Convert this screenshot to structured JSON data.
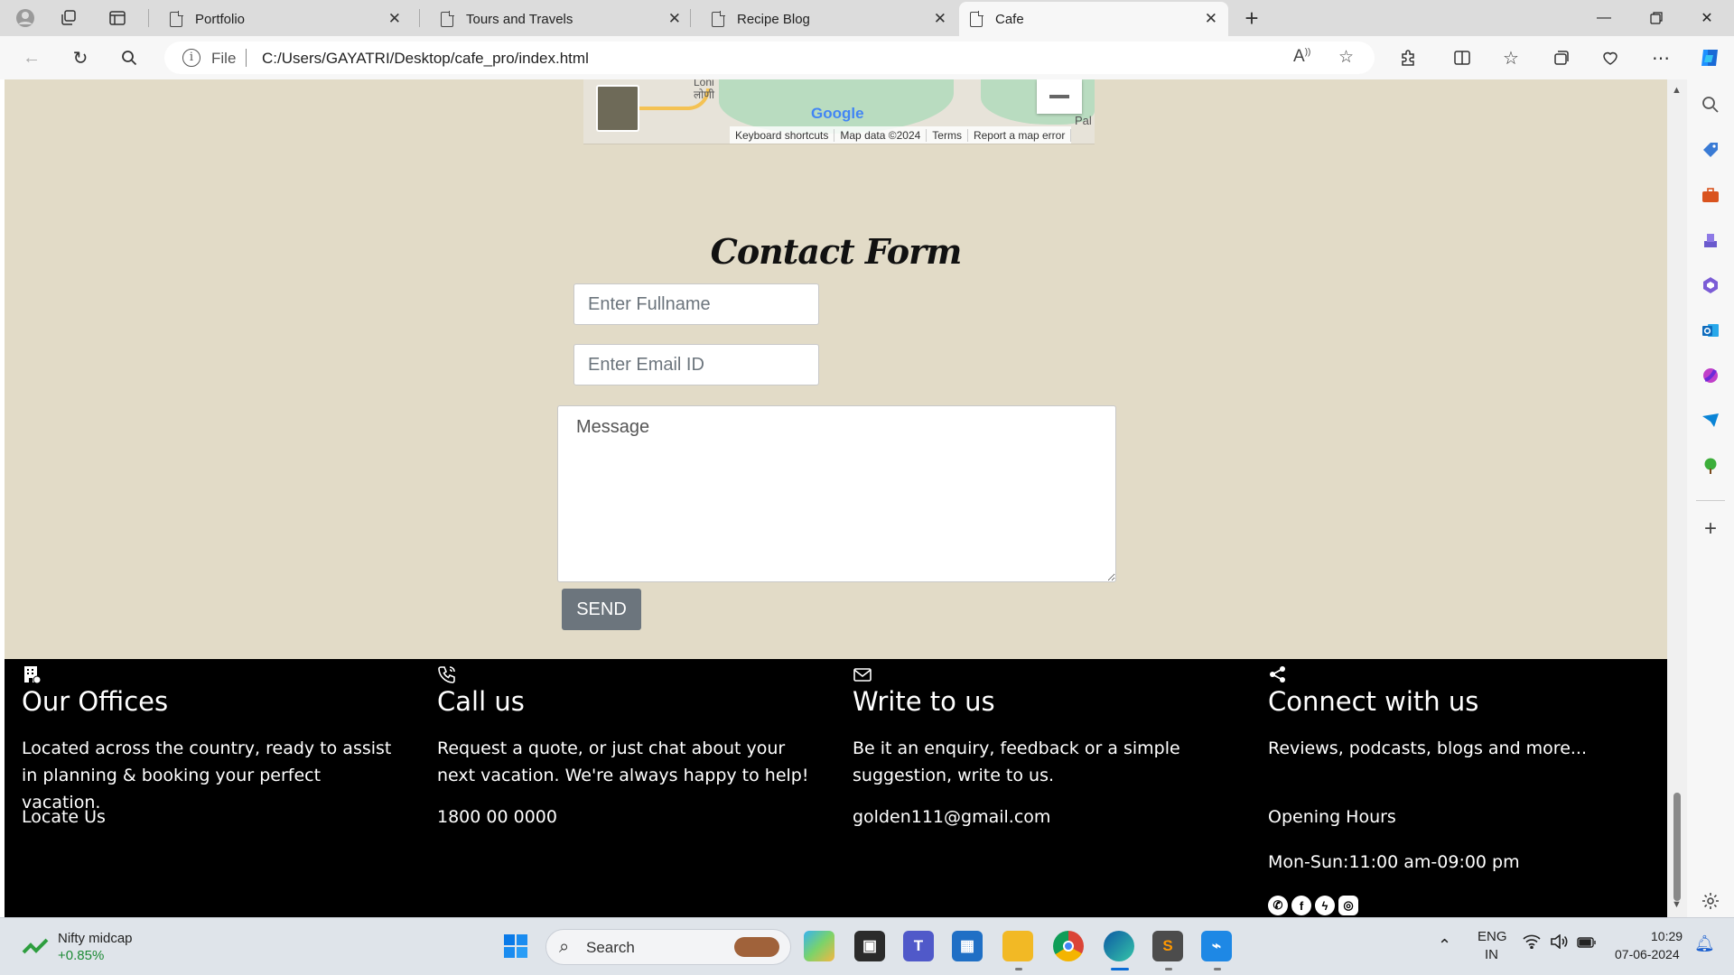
{
  "browser": {
    "tabs": [
      {
        "title": "Portfolio"
      },
      {
        "title": "Tours and Travels"
      },
      {
        "title": "Recipe Blog"
      },
      {
        "title": "Cafe"
      }
    ],
    "address": {
      "scheme_label": "File",
      "url": "C:/Users/GAYATRI/Desktop/cafe_pro/index.html"
    }
  },
  "map": {
    "brand": "Google",
    "places": [
      "Loni",
      "लोणी",
      "Pal"
    ],
    "attribution": [
      "Keyboard shortcuts",
      "Map data ©2024",
      "Terms",
      "Report a map error"
    ]
  },
  "contact_form": {
    "title": "Contact Form",
    "fullname_placeholder": "Enter Fullname",
    "email_placeholder": "Enter Email ID",
    "message_placeholder": "Message",
    "send_label": "SEND"
  },
  "footer": {
    "offices": {
      "title": "Our Offices",
      "desc": "Located across the country, ready to assist in planning & booking your perfect vacation.",
      "link": "Locate Us"
    },
    "call": {
      "title": "Call us",
      "desc": "Request a quote, or just chat about your next vacation. We're always happy to help!",
      "link": "1800 00 0000"
    },
    "write": {
      "title": "Write to us",
      "desc": "Be it an enquiry, feedback or a simple suggestion, write to us.",
      "link": "golden111@gmail.com"
    },
    "connect": {
      "title": "Connect with us",
      "desc": "Reviews, podcasts, blogs and more...",
      "link": "Opening Hours",
      "hours": "Mon-Sun:11:00 am-09:00 pm"
    },
    "social_icons": [
      "whatsapp-icon",
      "facebook-icon",
      "messenger-icon",
      "instagram-icon"
    ]
  },
  "taskbar": {
    "widget_name": "Nifty midcap",
    "widget_value": "+0.85%",
    "search_label": "Search",
    "lang": "ENG",
    "region": "IN",
    "time": "10:29",
    "date": "07-06-2024"
  },
  "colors": {
    "page_bg": "#e2dbc7",
    "footer_bg": "#000000",
    "send_bg": "#6c757d"
  }
}
